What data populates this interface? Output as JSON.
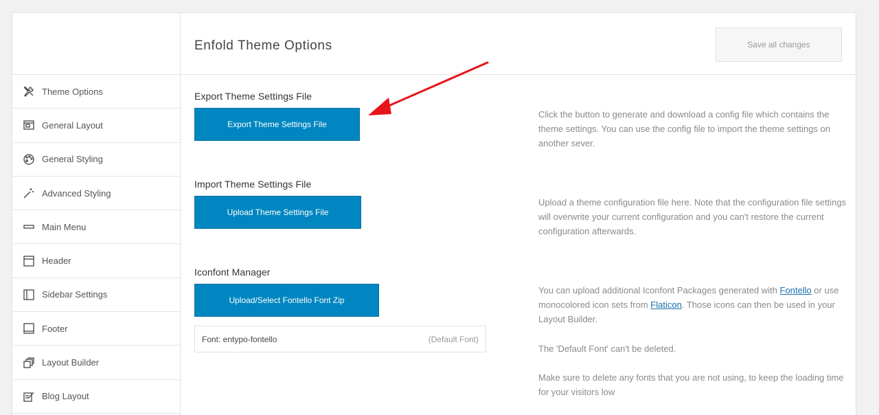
{
  "sidebar": {
    "items": [
      {
        "label": "Theme Options",
        "icon": "tools-icon"
      },
      {
        "label": "General Layout",
        "icon": "layout-icon"
      },
      {
        "label": "General Styling",
        "icon": "palette-icon"
      },
      {
        "label": "Advanced Styling",
        "icon": "magic-wand-icon"
      },
      {
        "label": "Main Menu",
        "icon": "menu-bar-icon"
      },
      {
        "label": "Header",
        "icon": "header-icon"
      },
      {
        "label": "Sidebar Settings",
        "icon": "sidebar-icon"
      },
      {
        "label": "Footer",
        "icon": "footer-icon"
      },
      {
        "label": "Layout Builder",
        "icon": "layout-builder-icon"
      },
      {
        "label": "Blog Layout",
        "icon": "blog-edit-icon"
      }
    ]
  },
  "header": {
    "title": "Enfold Theme Options",
    "save_label": "Save all changes"
  },
  "export": {
    "title": "Export Theme Settings File",
    "button": "Export Theme Settings File",
    "description": "Click the button to generate and download a config file which contains the theme settings. You can use the config file to import the theme settings on another sever."
  },
  "import": {
    "title": "Import Theme Settings File",
    "button": "Upload Theme Settings File",
    "description": "Upload a theme configuration file here. Note that the configuration file settings will overwrite your current configuration and you can't restore the current configuration afterwards."
  },
  "iconfont": {
    "title": "Iconfont Manager",
    "button": "Upload/Select Fontello Font Zip",
    "desc_part1": "You can upload additional Iconfont Packages generated with ",
    "link1": "Fontello",
    "desc_part2": " or use monocolored icon sets from ",
    "link2": "Flaticon",
    "desc_part3": ". Those icons can then be used in your Layout Builder.",
    "desc_default": "The 'Default Font' can't be deleted.",
    "desc_unused": "Make sure to delete any fonts that you are not using, to keep the loading time for your visitors low",
    "font_name": "Font: entypo-fontello",
    "font_badge": "(Default Font)"
  },
  "colors": {
    "accent": "#0086c0",
    "annotation_arrow": "#e8141b"
  }
}
